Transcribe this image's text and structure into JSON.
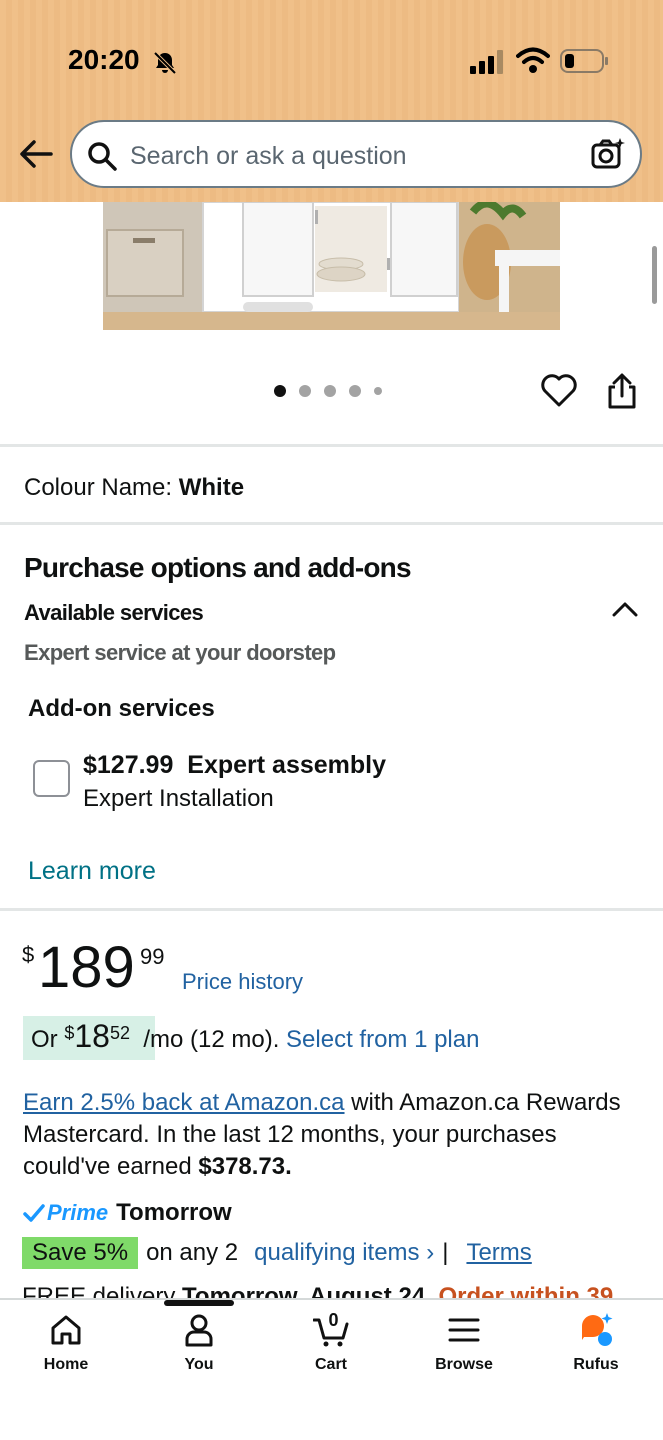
{
  "status_bar": {
    "time": "20:20"
  },
  "search": {
    "placeholder": "Search or ask a question"
  },
  "gallery": {
    "dot_count": 5,
    "active_index": 0
  },
  "colour": {
    "label": "Colour Name:",
    "value": "White"
  },
  "purchase_options": {
    "title": "Purchase options and add-ons",
    "available_services": "Available services",
    "subtitle": "Expert service at your doorstep",
    "addon_title": "Add-on services",
    "addon_price": "$127.99",
    "addon_name": "Expert assembly",
    "addon_desc": "Expert Installation",
    "learn_more": "Learn more"
  },
  "price": {
    "symbol": "$",
    "whole": "189",
    "fraction": "99",
    "history_link": "Price history"
  },
  "monthly": {
    "or": "Or",
    "symbol": "$",
    "whole": "18",
    "fraction": "52",
    "term": "/mo (12 mo).",
    "plan_link": "Select from 1 plan"
  },
  "rewards": {
    "link": "Earn 2.5% back at Amazon.ca",
    "text": " with Amazon.ca Rewards Mastercard. In the last 12 months, your purchases could've earned ",
    "amount": "$378.73."
  },
  "prime": {
    "word": "Prime",
    "day": "Tomorrow"
  },
  "save": {
    "badge": "Save 5%",
    "text": "on any 2",
    "qualifying": "qualifying items ›",
    "pipe": "|",
    "terms": "Terms"
  },
  "delivery": {
    "prefix": "FREE delivery ",
    "date": "Tomorrow, August 24.",
    "urgency": " Order within 39"
  },
  "nav": {
    "home": "Home",
    "you": "You",
    "cart": "Cart",
    "cart_count": "0",
    "browse": "Browse",
    "rufus": "Rufus"
  },
  "colors": {
    "header": "#f0c089",
    "link": "#2162a1",
    "teal_link": "#007185",
    "save_badge": "#7fda69",
    "monthly_badge": "#d7f0e6",
    "prime_blue": "#1a98ff",
    "urgency": "#c7511f",
    "rufus_orange": "#ff6a13",
    "rufus_blue": "#1a98ff"
  }
}
